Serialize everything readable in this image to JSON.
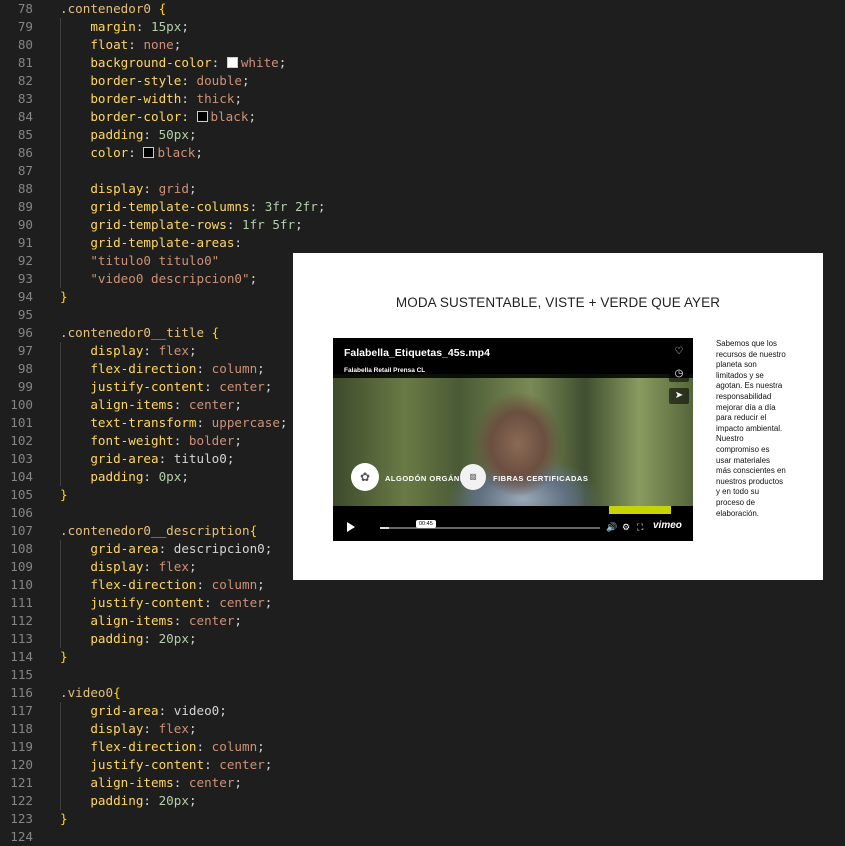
{
  "editor": {
    "lines": [
      {
        "n": "78",
        "indent": 0,
        "tokens": [
          [
            "sel",
            ".contenedor0 "
          ],
          [
            "br",
            "{"
          ]
        ]
      },
      {
        "n": "79",
        "indent": 1,
        "tokens": [
          [
            "prop",
            "margin"
          ],
          [
            "pun",
            ": "
          ],
          [
            "num",
            "15px"
          ],
          [
            "pun",
            ";"
          ]
        ]
      },
      {
        "n": "80",
        "indent": 1,
        "tokens": [
          [
            "prop",
            "float"
          ],
          [
            "pun",
            ": "
          ],
          [
            "val",
            "none"
          ],
          [
            "pun",
            ";"
          ]
        ]
      },
      {
        "n": "81",
        "indent": 1,
        "tokens": [
          [
            "prop",
            "background-color"
          ],
          [
            "pun",
            ": "
          ],
          [
            "swatch",
            "#ffffff"
          ],
          [
            "val",
            "white"
          ],
          [
            "pun",
            ";"
          ]
        ]
      },
      {
        "n": "82",
        "indent": 1,
        "tokens": [
          [
            "prop",
            "border-style"
          ],
          [
            "pun",
            ": "
          ],
          [
            "val",
            "double"
          ],
          [
            "pun",
            ";"
          ]
        ]
      },
      {
        "n": "83",
        "indent": 1,
        "tokens": [
          [
            "prop",
            "border-width"
          ],
          [
            "pun",
            ": "
          ],
          [
            "val",
            "thick"
          ],
          [
            "pun",
            ";"
          ]
        ]
      },
      {
        "n": "84",
        "indent": 1,
        "tokens": [
          [
            "prop",
            "border-color"
          ],
          [
            "pun",
            ": "
          ],
          [
            "swatch",
            "#000000"
          ],
          [
            "val",
            "black"
          ],
          [
            "pun",
            ";"
          ]
        ]
      },
      {
        "n": "85",
        "indent": 1,
        "tokens": [
          [
            "prop",
            "padding"
          ],
          [
            "pun",
            ": "
          ],
          [
            "num",
            "50px"
          ],
          [
            "pun",
            ";"
          ]
        ]
      },
      {
        "n": "86",
        "indent": 1,
        "tokens": [
          [
            "prop",
            "color"
          ],
          [
            "pun",
            ": "
          ],
          [
            "swatch",
            "#000000"
          ],
          [
            "val",
            "black"
          ],
          [
            "pun",
            ";"
          ]
        ]
      },
      {
        "n": "87",
        "indent": 0,
        "tokens": []
      },
      {
        "n": "88",
        "indent": 1,
        "tokens": [
          [
            "prop",
            "display"
          ],
          [
            "pun",
            ": "
          ],
          [
            "val",
            "grid"
          ],
          [
            "pun",
            ";"
          ]
        ]
      },
      {
        "n": "89",
        "indent": 1,
        "tokens": [
          [
            "prop",
            "grid-template-columns"
          ],
          [
            "pun",
            ": "
          ],
          [
            "num",
            "3fr 2fr"
          ],
          [
            "pun",
            ";"
          ]
        ]
      },
      {
        "n": "90",
        "indent": 1,
        "tokens": [
          [
            "prop",
            "grid-template-rows"
          ],
          [
            "pun",
            ": "
          ],
          [
            "num",
            "1fr 5fr"
          ],
          [
            "pun",
            ";"
          ]
        ]
      },
      {
        "n": "91",
        "indent": 1,
        "tokens": [
          [
            "prop",
            "grid-template-areas"
          ],
          [
            "pun",
            ":"
          ]
        ]
      },
      {
        "n": "92",
        "indent": 1,
        "tokens": [
          [
            "str",
            "\"titulo0 titulo0\""
          ]
        ]
      },
      {
        "n": "93",
        "indent": 1,
        "tokens": [
          [
            "str",
            "\"video0 descripcion0\""
          ],
          [
            "pun",
            ";"
          ]
        ]
      },
      {
        "n": "94",
        "indent": 0,
        "tokens": [
          [
            "br",
            "}"
          ]
        ]
      },
      {
        "n": "95",
        "indent": 0,
        "tokens": []
      },
      {
        "n": "96",
        "indent": 0,
        "tokens": [
          [
            "sel",
            ".contenedor0__title "
          ],
          [
            "br",
            "{"
          ]
        ]
      },
      {
        "n": "97",
        "indent": 1,
        "tokens": [
          [
            "prop",
            "display"
          ],
          [
            "pun",
            ": "
          ],
          [
            "val",
            "flex"
          ],
          [
            "pun",
            ";"
          ]
        ]
      },
      {
        "n": "98",
        "indent": 1,
        "tokens": [
          [
            "prop",
            "flex-direction"
          ],
          [
            "pun",
            ": "
          ],
          [
            "val",
            "column"
          ],
          [
            "pun",
            ";"
          ]
        ]
      },
      {
        "n": "99",
        "indent": 1,
        "tokens": [
          [
            "prop",
            "justify-content"
          ],
          [
            "pun",
            ": "
          ],
          [
            "val",
            "center"
          ],
          [
            "pun",
            ";"
          ]
        ]
      },
      {
        "n": "100",
        "indent": 1,
        "tokens": [
          [
            "prop",
            "align-items"
          ],
          [
            "pun",
            ": "
          ],
          [
            "val",
            "center"
          ],
          [
            "pun",
            ";"
          ]
        ]
      },
      {
        "n": "101",
        "indent": 1,
        "tokens": [
          [
            "prop",
            "text-transform"
          ],
          [
            "pun",
            ": "
          ],
          [
            "val",
            "uppercase"
          ],
          [
            "pun",
            ";"
          ]
        ]
      },
      {
        "n": "102",
        "indent": 1,
        "tokens": [
          [
            "prop",
            "font-weight"
          ],
          [
            "pun",
            ": "
          ],
          [
            "val",
            "bolder"
          ],
          [
            "pun",
            ";"
          ]
        ]
      },
      {
        "n": "103",
        "indent": 1,
        "tokens": [
          [
            "prop",
            "grid-area"
          ],
          [
            "pun",
            ": "
          ],
          [
            "plain",
            "titulo0"
          ],
          [
            "pun",
            ";"
          ]
        ]
      },
      {
        "n": "104",
        "indent": 1,
        "tokens": [
          [
            "prop",
            "padding"
          ],
          [
            "pun",
            ": "
          ],
          [
            "num",
            "0px"
          ],
          [
            "pun",
            ";"
          ]
        ]
      },
      {
        "n": "105",
        "indent": 0,
        "tokens": [
          [
            "br",
            "}"
          ]
        ]
      },
      {
        "n": "106",
        "indent": 0,
        "tokens": []
      },
      {
        "n": "107",
        "indent": 0,
        "tokens": [
          [
            "sel",
            ".contenedor0__description"
          ],
          [
            "br",
            "{"
          ]
        ]
      },
      {
        "n": "108",
        "indent": 1,
        "tokens": [
          [
            "prop",
            "grid-area"
          ],
          [
            "pun",
            ": "
          ],
          [
            "plain",
            "descripcion0"
          ],
          [
            "pun",
            ";"
          ]
        ]
      },
      {
        "n": "109",
        "indent": 1,
        "tokens": [
          [
            "prop",
            "display"
          ],
          [
            "pun",
            ": "
          ],
          [
            "val",
            "flex"
          ],
          [
            "pun",
            ";"
          ]
        ]
      },
      {
        "n": "110",
        "indent": 1,
        "tokens": [
          [
            "prop",
            "flex-direction"
          ],
          [
            "pun",
            ": "
          ],
          [
            "val",
            "column"
          ],
          [
            "pun",
            ";"
          ]
        ]
      },
      {
        "n": "111",
        "indent": 1,
        "tokens": [
          [
            "prop",
            "justify-content"
          ],
          [
            "pun",
            ": "
          ],
          [
            "val",
            "center"
          ],
          [
            "pun",
            ";"
          ]
        ]
      },
      {
        "n": "112",
        "indent": 1,
        "tokens": [
          [
            "prop",
            "align-items"
          ],
          [
            "pun",
            ": "
          ],
          [
            "val",
            "center"
          ],
          [
            "pun",
            ";"
          ]
        ]
      },
      {
        "n": "113",
        "indent": 1,
        "tokens": [
          [
            "prop",
            "padding"
          ],
          [
            "pun",
            ": "
          ],
          [
            "num",
            "20px"
          ],
          [
            "pun",
            ";"
          ]
        ]
      },
      {
        "n": "114",
        "indent": 0,
        "tokens": [
          [
            "br",
            "}"
          ]
        ]
      },
      {
        "n": "115",
        "indent": 0,
        "tokens": []
      },
      {
        "n": "116",
        "indent": 0,
        "tokens": [
          [
            "sel",
            ".video0"
          ],
          [
            "br",
            "{"
          ]
        ]
      },
      {
        "n": "117",
        "indent": 1,
        "tokens": [
          [
            "prop",
            "grid-area"
          ],
          [
            "pun",
            ": "
          ],
          [
            "plain",
            "video0"
          ],
          [
            "pun",
            ";"
          ]
        ]
      },
      {
        "n": "118",
        "indent": 1,
        "tokens": [
          [
            "prop",
            "display"
          ],
          [
            "pun",
            ": "
          ],
          [
            "val",
            "flex"
          ],
          [
            "pun",
            ";"
          ]
        ]
      },
      {
        "n": "119",
        "indent": 1,
        "tokens": [
          [
            "prop",
            "flex-direction"
          ],
          [
            "pun",
            ": "
          ],
          [
            "val",
            "column"
          ],
          [
            "pun",
            ";"
          ]
        ]
      },
      {
        "n": "120",
        "indent": 1,
        "tokens": [
          [
            "prop",
            "justify-content"
          ],
          [
            "pun",
            ": "
          ],
          [
            "val",
            "center"
          ],
          [
            "pun",
            ";"
          ]
        ]
      },
      {
        "n": "121",
        "indent": 1,
        "tokens": [
          [
            "prop",
            "align-items"
          ],
          [
            "pun",
            ": "
          ],
          [
            "val",
            "center"
          ],
          [
            "pun",
            ";"
          ]
        ]
      },
      {
        "n": "122",
        "indent": 1,
        "tokens": [
          [
            "prop",
            "padding"
          ],
          [
            "pun",
            ": "
          ],
          [
            "num",
            "20px"
          ],
          [
            "pun",
            ";"
          ]
        ]
      },
      {
        "n": "123",
        "indent": 0,
        "tokens": [
          [
            "br",
            "}"
          ]
        ]
      },
      {
        "n": "124",
        "indent": 0,
        "tokens": []
      }
    ]
  },
  "preview": {
    "title": "MODA SUSTENTABLE, VISTE + VERDE QUE AYER",
    "video": {
      "filename": "Falabella_Etiquetas_45s.mp4",
      "author": "Falabella Retail Prensa CL",
      "time": "00:45",
      "progress": 0.04,
      "brand": "vimeo",
      "logo_left_text": "ALGODÓN ORGÁNICO",
      "logo_right_text": "FIBRAS CERTIFICADAS",
      "icons": {
        "like": "heart-icon",
        "later": "clock-icon",
        "share": "send-icon",
        "volume": "volume-icon",
        "settings": "gear-icon",
        "fullscreen": "fullscreen-icon"
      }
    },
    "description": "Sabemos que los recursos de nuestro planeta son limitados y se agotan. Es nuestra responsabilidad mejorar día a día para reducir el impacto ambiental. Nuestro compromiso es usar materiales más conscientes en nuestros productos y en todo su proceso de elaboración."
  }
}
